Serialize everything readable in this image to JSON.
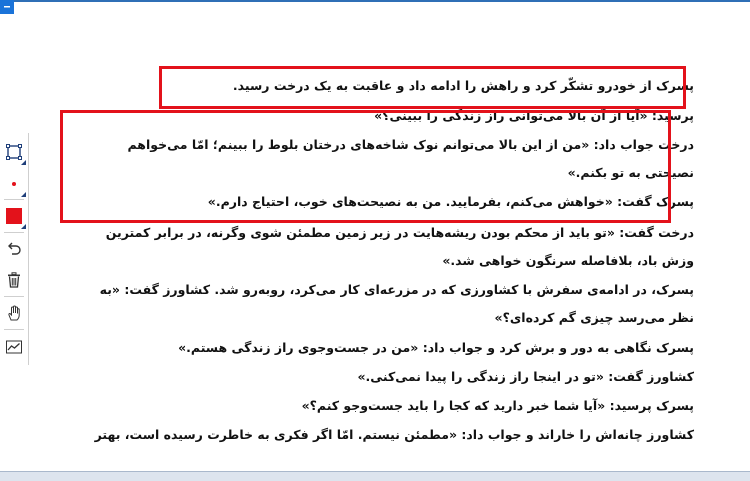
{
  "toolbar": {
    "tools": [
      {
        "name": "rectangle-select-tool",
        "icon": "rectangle-select-icon"
      },
      {
        "name": "stroke-size-tool",
        "icon": "dot-icon"
      },
      {
        "name": "color-tool",
        "icon": "red-swatch-icon",
        "color": "#e3121b"
      },
      {
        "name": "undo-tool",
        "icon": "undo-icon"
      },
      {
        "name": "delete-tool",
        "icon": "trash-icon"
      },
      {
        "name": "pan-tool",
        "icon": "hand-icon"
      },
      {
        "name": "line-tool",
        "icon": "line-chart-icon"
      }
    ]
  },
  "highlight_color": "#e3121b",
  "document": {
    "lines": [
      "پسرک از خودرو تشکّر کرد و راهش را ادامه داد و عاقبت به یک درخت رسید.",
      "پرسید: «آیا از آن بالا می‌توانی راز زندگی را ببینی؟»",
      "درخت جواب داد: «من از این بالا می‌توانم نوک شاخه‌های درختان بلوط را ببینم؛ امّا می‌خواهم",
      "نصیحتی به تو بکنم.»",
      "پسرک گفت: «خواهش می‌کنم، بفرمایید. من به نصیحت‌های خوب، احتیاج دارم.»",
      "درخت گفت: «تو باید از محکم بودن ریشه‌هایت در زیر زمین مطمئن شوی وگرنه، در برابر کمترین",
      "وزش باد، بلافاصله سرنگون خواهی شد.»",
      "پسرک، در ادامه‌ی سفرش با کشاورزی که در مزرعه‌ای کار می‌کرد، روبه‌رو شد. کشاورز گفت: «به",
      "نظر می‌رسد چیزی گم کرده‌ای؟»",
      "پسرک نگاهی به دور و برش کرد و جواب داد: «من در جست‌وجوی راز زندگی هستم.»",
      "کشاورز گفت: «تو در اینجا راز زندگی را پیدا نمی‌کنی.»",
      "پسرک پرسید: «آیا شما خبر دارید که کجا را باید جست‌وجو کنم؟»",
      "کشاورز چانه‌اش را خاراند و جواب داد: «مطمئن نیستم. امّا اگر فکری به خاطرت رسیده است، بهتر"
    ]
  }
}
